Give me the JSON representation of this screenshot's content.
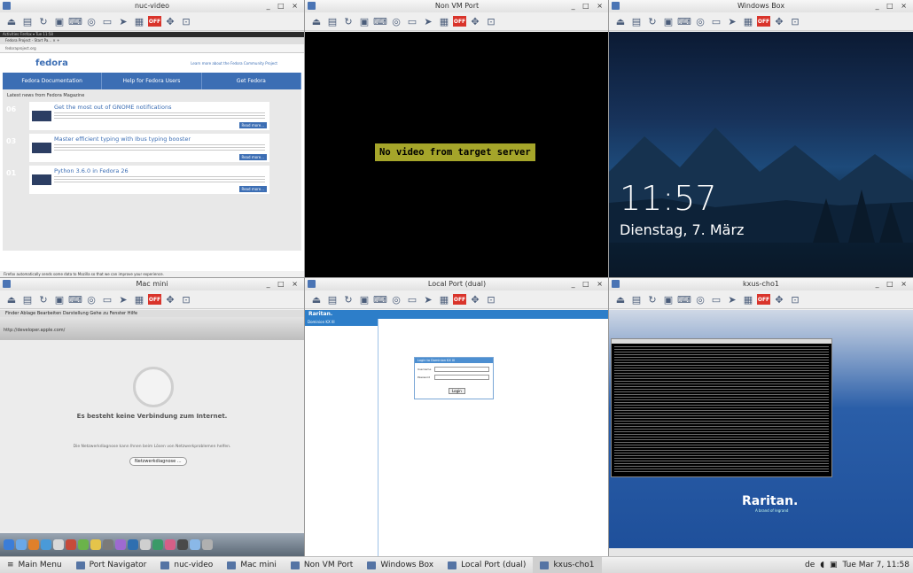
{
  "windows": [
    {
      "title": "nuc-video"
    },
    {
      "title": "Non VM Port"
    },
    {
      "title": "Windows Box"
    },
    {
      "title": "Mac mini"
    },
    {
      "title": "Local Port (dual)"
    },
    {
      "title": "kxus-cho1"
    }
  ],
  "window_controls": "_ □ ×",
  "toolbar_icons": [
    "disconnect-icon",
    "properties-icon",
    "refresh-icon",
    "connection-icon",
    "keyboard-icon",
    "mouse-icon",
    "single-cursor-icon",
    "pointer-icon",
    "screen-icon",
    "smart-card-icon",
    "record-icon",
    "move-icon",
    "fit-icon"
  ],
  "nuc": {
    "os_bar": "Activities   Firefox ▾                          Tue 11:58",
    "tab": "Fedora Project - Start Pa...  ×  +",
    "url": "fedoraproject.org",
    "logo": "fedora",
    "note": "Learn more about the Fedora Community Project",
    "nav": [
      "Fedora Documentation",
      "Help for Fedora Users",
      "Get Fedora"
    ],
    "news_head": "Latest news from Fedora Magazine",
    "cards": [
      {
        "date": "06",
        "title": "Get the most out of GNOME notifications",
        "more": "Read more..."
      },
      {
        "date": "03",
        "title": "Master efficient typing with Ibus typing booster",
        "more": "Read more..."
      },
      {
        "date": "01",
        "title": "Python 3.6.0 in Fedora 26",
        "more": "Read more..."
      }
    ],
    "status": "Firefox automatically sends some data to Mozilla so that we can improve your experience."
  },
  "novideo": {
    "message": "No video from target server"
  },
  "winbox": {
    "time": "11:57",
    "date": "Dienstag, 7. März"
  },
  "mac": {
    "menubar": "Finder  Ablage  Bearbeiten  Darstellung  Gehe zu  Fenster  Hilfe",
    "url": "http://developer.apple.com/",
    "message": "Es besteht keine Verbindung zum Internet.",
    "sub": "Die Netzwerkdiagnose kann Ihnen beim Lösen von Netzwerkproblemen helfen.",
    "button": "Netzwerkdiagnose ..."
  },
  "local": {
    "brand": "Raritan.",
    "side_head": "Dominion KX III",
    "login_title": "Login to Dominion KX III",
    "username_label": "Username",
    "password_label": "Password",
    "login_button": "Login"
  },
  "kxus": {
    "brand": "Raritan.",
    "sub": "A brand of legrand"
  },
  "taskbar": {
    "items": [
      "Main Menu",
      "Port Navigator",
      "nuc-video",
      "Mac mini",
      "Non VM Port",
      "Windows Box",
      "Local Port (dual)",
      "kxus-cho1"
    ],
    "lang": "de",
    "clock": "Tue Mar  7, 11:58"
  },
  "colors": {
    "fedora_blue": "#3c6eb4",
    "novideo_bg": "#a5a52a",
    "raritan_blue": "#2d7ec9"
  }
}
